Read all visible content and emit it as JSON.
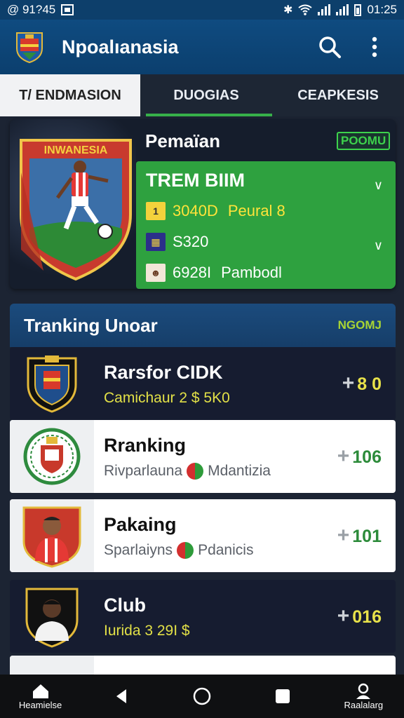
{
  "status": {
    "left_text": "@ 91?45",
    "time": "01:25"
  },
  "app": {
    "title": "Npoalıanasia"
  },
  "tabs": [
    {
      "label": "T/ ENDMASION"
    },
    {
      "label": "DUOGIAS"
    },
    {
      "label": "CEAPKESIS"
    }
  ],
  "hero": {
    "card_text": "INWANESIA",
    "label": "Pemaïan",
    "badge": "POOMU",
    "panel_title": "TREM BIIM",
    "rows": [
      {
        "icon": "coin-icon",
        "text": "3040D",
        "extra": "Peural 8"
      },
      {
        "icon": "stats-icon",
        "text": "S320"
      },
      {
        "icon": "player-icon",
        "text": "6928I",
        "extra": "Pambodl"
      }
    ]
  },
  "ranking": {
    "heading": "Tranking Unoar",
    "badge": "NGOMJ",
    "items": [
      {
        "name": "Rarsfor CIDK",
        "sub": "Camichaur 2 $ 5K0",
        "value": "8 0",
        "style": "dark"
      },
      {
        "name": "Rranking",
        "sub_a": "Rivparlauna",
        "sub_b": "Mdantizia",
        "value": "106",
        "style": "light"
      },
      {
        "name": "Pakaing",
        "sub_a": "Sparlaiyns",
        "sub_b": "Pdanicis",
        "value": "101",
        "style": "light"
      },
      {
        "name": "Club",
        "sub": "Iurida 3 29I $",
        "value": "016",
        "style": "dark"
      }
    ]
  },
  "navbar": {
    "home_label": "Heamielse",
    "profile_label": "Raalalarg"
  },
  "colors": {
    "appbar": "#0f4b80",
    "accent_green": "#2ea13f",
    "dark_row": "#161c30"
  }
}
